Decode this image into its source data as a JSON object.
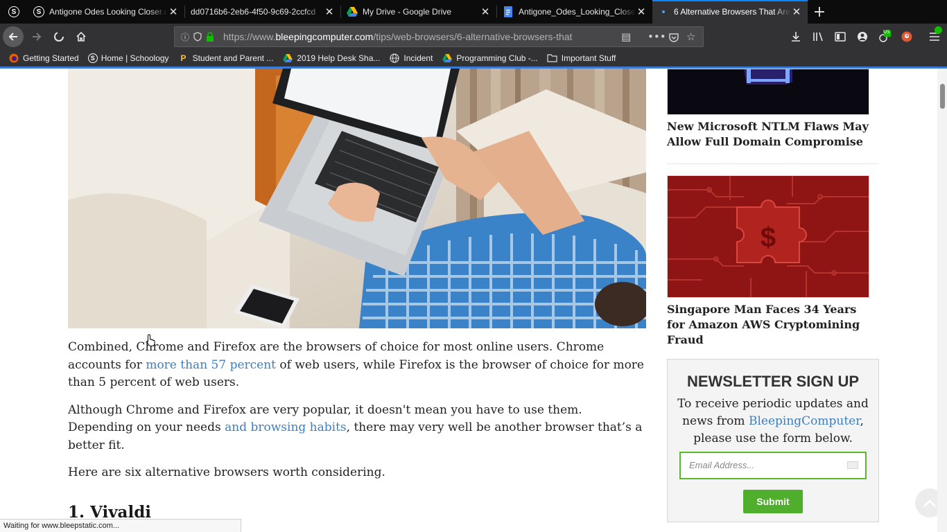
{
  "tabs": [
    {
      "title": "Antigone Odes Looking Closer.d",
      "icon": "schoology-icon",
      "active": false
    },
    {
      "title": "dd0716b6-2eb6-4f50-9c69-2ccfcd",
      "icon": "none",
      "active": false
    },
    {
      "title": "My Drive - Google Drive",
      "icon": "google-drive-icon",
      "active": false
    },
    {
      "title": "Antigone_Odes_Looking_Closer",
      "icon": "google-docs-icon",
      "active": false
    },
    {
      "title": "6 Alternative Browsers That Are",
      "icon": "loading-dot-icon",
      "active": true
    }
  ],
  "navbar": {
    "url_prefix": "https://www.",
    "url_domain": "bleepingcomputer.com",
    "url_path": "/tips/web-browsers/6-alternative-browsers-that",
    "badge": "US"
  },
  "bookmarks": [
    {
      "label": "Getting Started",
      "icon": "firefox-icon"
    },
    {
      "label": "Home | Schoology",
      "icon": "schoology-icon"
    },
    {
      "label": "Student and Parent ...",
      "icon": "powerschool-icon"
    },
    {
      "label": "2019 Help Desk Sha...",
      "icon": "google-drive-icon"
    },
    {
      "label": "Incident",
      "icon": "globe-icon"
    },
    {
      "label": "Programming Club -...",
      "icon": "google-drive-icon"
    },
    {
      "label": "Important Stuff",
      "icon": "folder-icon"
    }
  ],
  "article": {
    "p1_a": "Combined, Chrome and Firefox are the browsers of choice for most online users. Chrome accounts for ",
    "p1_link": "more than 57 percent",
    "p1_b": " of web users, while Firefox is the browser of choice for more than 5 percent of web users.",
    "p2_a": "Although Chrome and Firefox are very popular, it doesn't mean you have to use them. Depending on your needs ",
    "p2_link": "and browsing habits",
    "p2_b": ", there may very well be another browser that’s a better fit.",
    "p3": "Here are six alternative browsers worth considering.",
    "h_vivaldi": "1. Vivaldi"
  },
  "sidebar": {
    "story1_title": "New Microsoft NTLM Flaws May Allow Full Domain Compromise",
    "story2_title": "Singapore Man Faces 34 Years for Amazon AWS Cryptomining Fraud"
  },
  "newsletter": {
    "title": "NEWSLETTER SIGN UP",
    "text_a": "To receive periodic updates and news from ",
    "text_link": "BleepingComputer",
    "text_b": ", please use the form below.",
    "email_placeholder": "Email Address...",
    "submit_label": "Submit"
  },
  "status": "Waiting for www.bleepstatic.com...",
  "colors": {
    "tab_bar": "#0c0c0d",
    "toolbar": "#323234",
    "accent": "#0a84ff",
    "link": "#3d7ebf",
    "submit_green": "#4fae2b"
  }
}
